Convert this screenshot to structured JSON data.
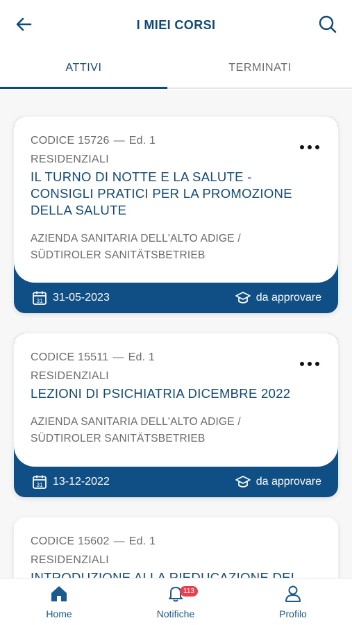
{
  "header": {
    "title": "I MIEI CORSI",
    "back_icon": "arrow-left-icon",
    "search_icon": "search-icon"
  },
  "tabs": [
    {
      "label": "ATTIVI",
      "active": true
    },
    {
      "label": "TERMINATI",
      "active": false
    }
  ],
  "courses": [
    {
      "code": "CODICE 15726",
      "edition": "Ed. 1",
      "category": "RESIDENZIALI",
      "title_lines": [
        "IL TURNO DI NOTTE E LA SALUTE -",
        "CONSIGLI PRATICI PER LA PROMOZIONE",
        "DELLA SALUTE"
      ],
      "org_lines": [
        "AZIENDA SANITARIA DELL'ALTO ADIGE /",
        "SÜDTIROLER SANITÄTSBETRIEB"
      ],
      "date": "31-05-2023",
      "status": "da approvare"
    },
    {
      "code": "CODICE 15511",
      "edition": "Ed. 1",
      "category": "RESIDENZIALI",
      "title_lines": [
        "LEZIONI DI PSICHIATRIA DICEMBRE 2022"
      ],
      "org_lines": [
        "AZIENDA SANITARIA DELL'ALTO ADIGE /",
        "SÜDTIROLER SANITÄTSBETRIEB"
      ],
      "date": "13-12-2022",
      "status": "da approvare"
    },
    {
      "code": "CODICE 15602",
      "edition": "Ed. 1",
      "category": "RESIDENZIALI",
      "title_lines": [
        "INTRODUZIONE ALLA RIEDUCAZIONE DEL"
      ]
    }
  ],
  "bottom_nav": {
    "home": {
      "label": "Home",
      "icon": "home-icon"
    },
    "notifications": {
      "label": "Notifiche",
      "icon": "bell-icon",
      "badge": "113"
    },
    "profile": {
      "label": "Profilo",
      "icon": "user-icon"
    }
  },
  "colors": {
    "primary": "#134a75",
    "card_footer": "#104f86",
    "badge": "#e8404e",
    "muted_text": "#6b6b6b"
  }
}
